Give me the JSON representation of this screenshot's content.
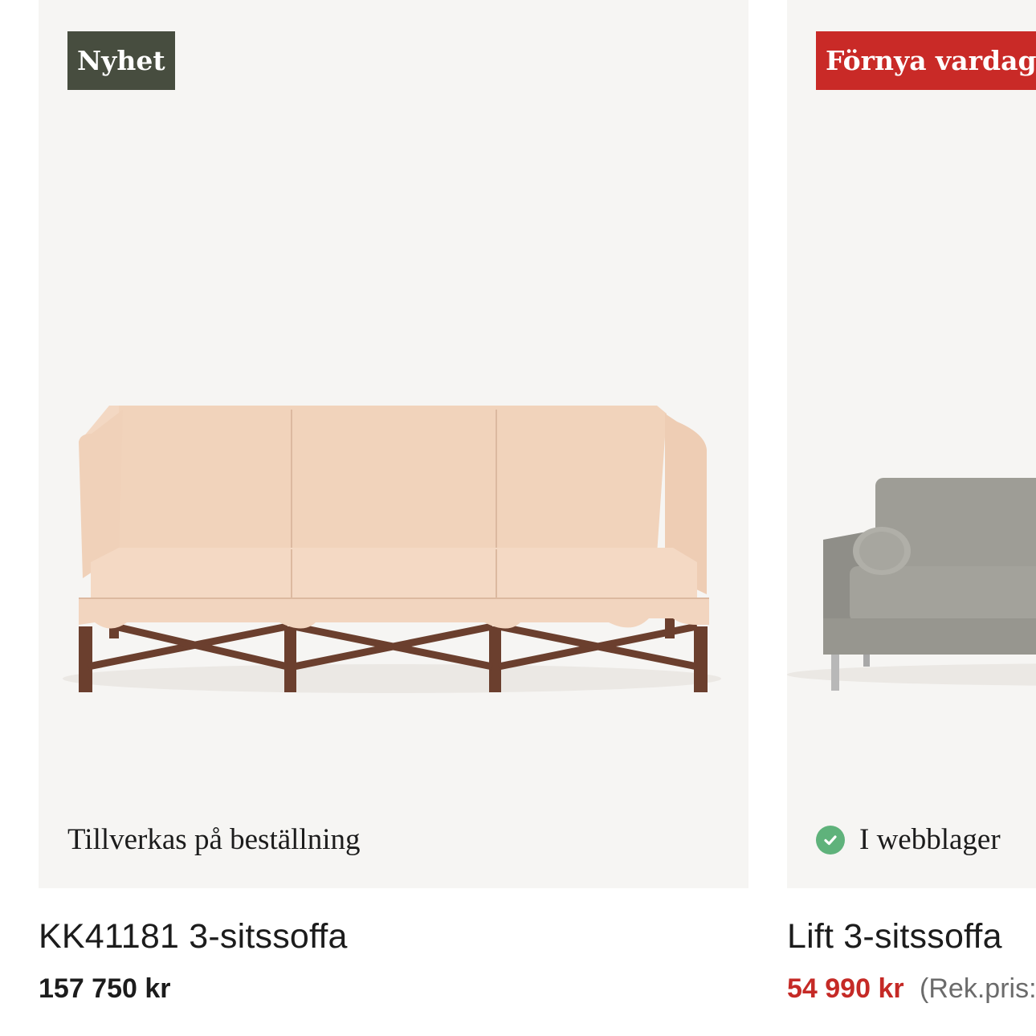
{
  "products": [
    {
      "badge": "Nyhet",
      "badge_color": "#474d3f",
      "availability": "Tillverkas på beställning",
      "in_stock": false,
      "title": "KK41181 3-sitssoffa",
      "price": "157 750 kr",
      "image_icon": "leather-sofa-image"
    },
    {
      "badge": "Förnya vardags",
      "badge_color": "#c92a27",
      "availability": "I webblager",
      "in_stock": true,
      "stock_icon_color": "#5fb27b",
      "title": "Lift 3-sitssoffa",
      "price": "54 990 kr",
      "price_color": "#c52a26",
      "rek_price": "(Rek.pris:",
      "image_icon": "grey-sofa-image"
    }
  ]
}
